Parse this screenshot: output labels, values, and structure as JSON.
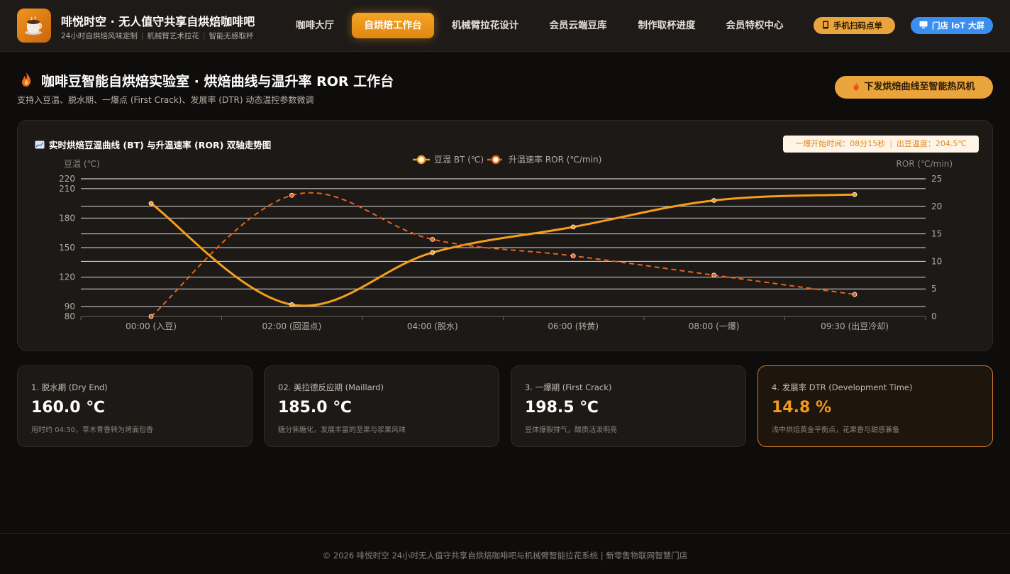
{
  "header": {
    "brand_title": "啡悦时空 · 无人值守共享自烘焙咖啡吧",
    "brand_tags": [
      "24小时自烘焙风味定制",
      "机械臂艺术拉花",
      "智能无感取杯"
    ],
    "nav": [
      "咖啡大厅",
      "自烘焙工作台",
      "机械臂拉花设计",
      "会员云端豆库",
      "制作取杯进度",
      "会员特权中心"
    ],
    "active_nav": "自烘焙工作台",
    "scan_label": "手机扫码点单",
    "iot_label": "门店 IoT 大屏"
  },
  "page": {
    "title": "咖啡豆智能自烘焙实验室 · 烘焙曲线与温升率 ROR 工作台",
    "subtitle": "支持入豆温、脱水期、一爆点 (First Crack)、发展率 (DTR) 动态温控参数微调",
    "push_button": "下发烘焙曲线至智能热风机"
  },
  "chart_card": {
    "title": "实时烘焙豆温曲线 (BT) 与升温速率 (ROR) 双轴走势图",
    "badge_first_crack": "一爆开始时间：08分15秒",
    "badge_drop_temp": "出豆温度：204.5℃"
  },
  "chart_data": {
    "type": "line",
    "categories": [
      "00:00 (入豆)",
      "02:00 (回温点)",
      "04:00 (脱水)",
      "06:00 (转黄)",
      "08:00 (一爆)",
      "09:30 (出豆冷却)"
    ],
    "series": [
      {
        "name": "豆温 BT (℃)",
        "axis": "left",
        "style": "solid",
        "color": "#f59e1b",
        "values": [
          195,
          92,
          145,
          171,
          198,
          204
        ]
      },
      {
        "name": "升温速率 ROR (℃/min)",
        "axis": "right",
        "style": "dashed",
        "color": "#e8621c",
        "values": [
          0,
          22,
          14,
          11,
          7.5,
          4
        ]
      }
    ],
    "ylabel_left": "豆温 (℃)",
    "ylabel_right": "ROR (℃/min)",
    "y_left_ticks": [
      80,
      90,
      120,
      150,
      180,
      210,
      220
    ],
    "y_right_ticks": [
      0,
      5,
      10,
      15,
      20,
      25
    ],
    "ylim_left": [
      80,
      220
    ],
    "ylim_right": [
      0,
      25
    ],
    "legend_position": "top-center",
    "grid": true
  },
  "stats": [
    {
      "label": "1. 脱水期 (Dry End)",
      "value": "160.0 ℃",
      "desc": "用时约 04:30，草木青香转为烤面包香"
    },
    {
      "label": "02. 美拉德反应期 (Maillard)",
      "value": "185.0 ℃",
      "desc": "糖分焦糖化，发展丰富的坚果与浆果风味"
    },
    {
      "label": "3. 一爆期 (First Crack)",
      "value": "198.5 ℃",
      "desc": "豆体爆裂排气，酸质活泼明亮"
    },
    {
      "label": "4. 发展率 DTR (Development Time)",
      "value": "14.8 %",
      "desc": "浅中烘焙黄金平衡点，花果香与甜感兼备"
    }
  ],
  "footer": "© 2026 啡悦时空 24小时无人值守共享自烘焙咖啡吧与机械臂智能拉花系统 | 新零售物联网智慧门店",
  "colors": {
    "accent": "#f59e1b",
    "ror": "#e8621c",
    "iot": "#3a8ef0"
  }
}
